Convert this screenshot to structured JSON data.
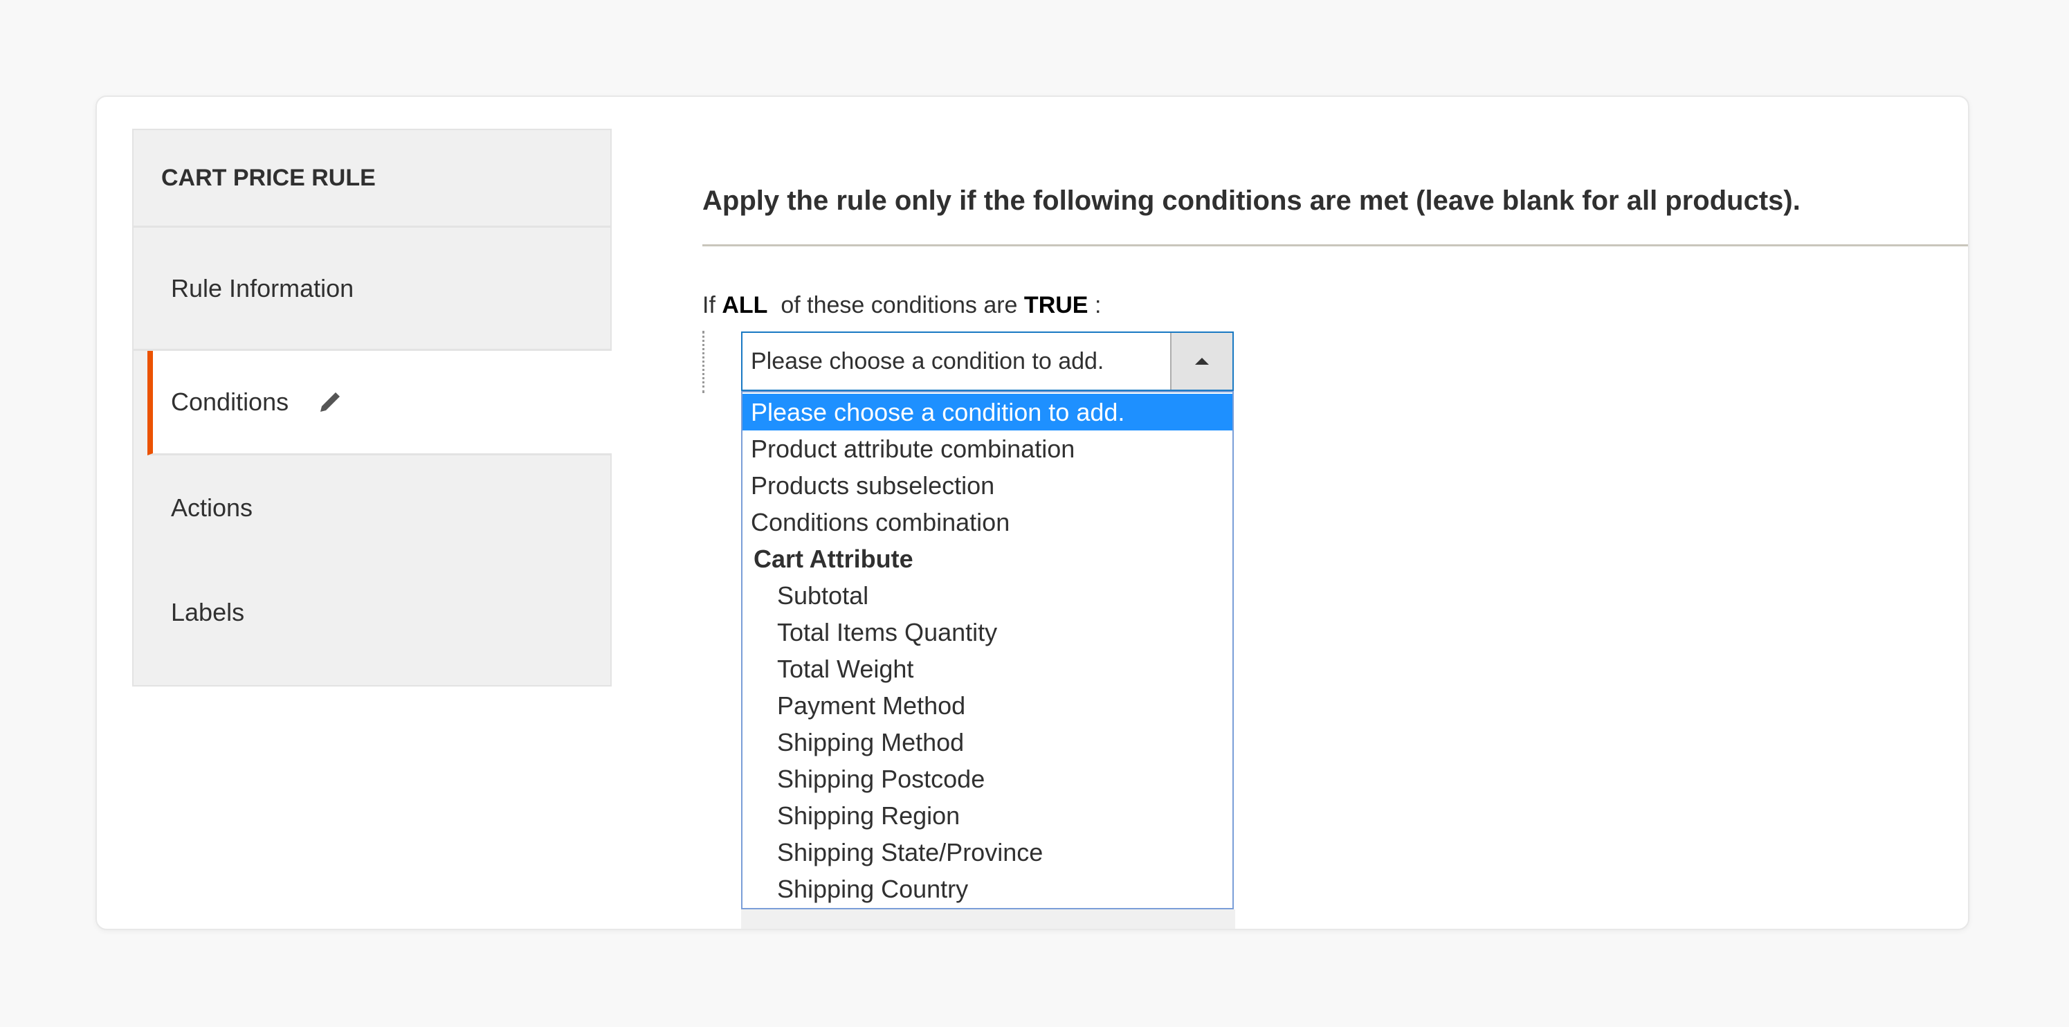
{
  "sidebar": {
    "title": "CART PRICE RULE",
    "items": [
      {
        "label": "Rule Information"
      },
      {
        "label": "Conditions",
        "icon": "pencil-icon"
      },
      {
        "label": "Actions"
      },
      {
        "label": "Labels"
      }
    ],
    "accent": "#eb5202"
  },
  "main": {
    "heading": "Apply the rule only if the following conditions are met (leave blank for all products).",
    "condition": {
      "prefix": "If",
      "aggregator": "ALL",
      "middle": "of these conditions are",
      "value": "TRUE",
      "suffix": ":"
    },
    "select": {
      "value": "Please choose a condition to add.",
      "options": [
        "Please choose a condition to add.",
        "Product attribute combination",
        "Products subselection",
        "Conditions combination"
      ],
      "group": {
        "label": "Cart Attribute",
        "options": [
          "Subtotal",
          "Total Items Quantity",
          "Total Weight",
          "Payment Method",
          "Shipping Method",
          "Shipping Postcode",
          "Shipping Region",
          "Shipping State/Province",
          "Shipping Country"
        ]
      },
      "highlight_color": "#1e90ff"
    }
  }
}
